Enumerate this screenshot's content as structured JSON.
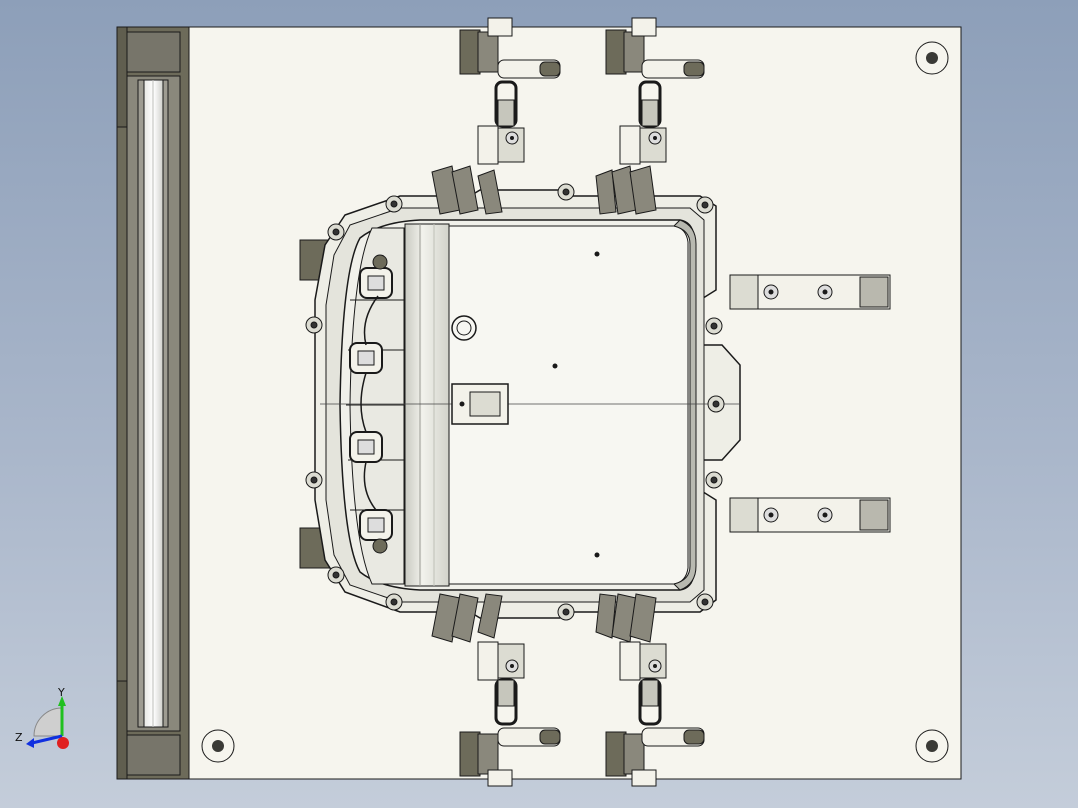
{
  "viewport": {
    "background_top": "#8d9fb9",
    "background_bottom": "#c4cdda"
  },
  "model": {
    "plate_color": "#f6f5ee",
    "part_color": "#eeeee6",
    "clamp_color": "#6d6b5a",
    "edge_color": "#1a1a1a"
  },
  "triad": {
    "y_label": "Y",
    "z_label": "Z",
    "y_color": "#20c020",
    "z_color": "#1030e0",
    "x_color": "#e02020"
  }
}
